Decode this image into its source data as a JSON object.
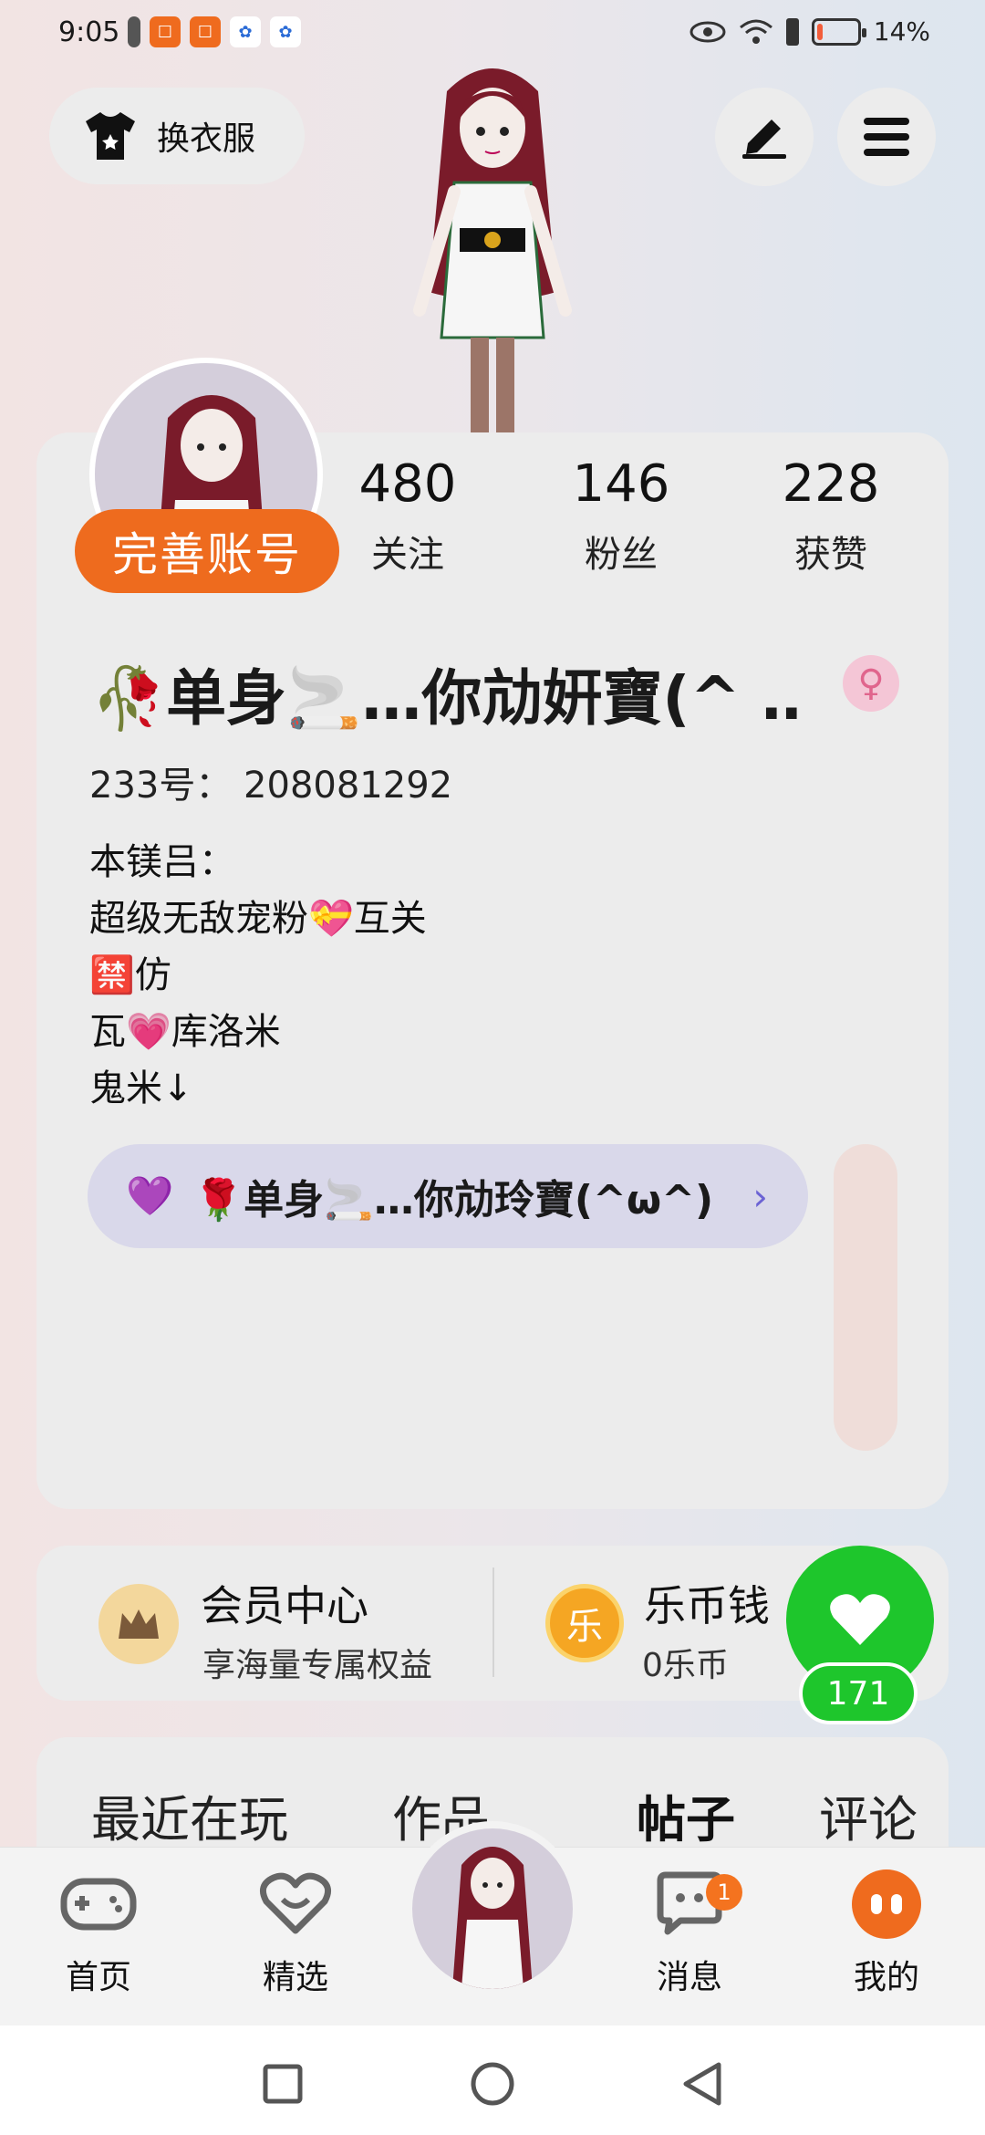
{
  "status_bar": {
    "time": "9:05",
    "battery": "14%",
    "battery_level": 0.14,
    "icons": [
      "alert-icon",
      "app-icon",
      "app-icon",
      "paw-icon",
      "paw-icon",
      "eye-icon",
      "wifi-icon",
      "alert-icon",
      "battery-icon"
    ]
  },
  "header": {
    "dress_label": "换衣服",
    "edit_icon": "edit-icon",
    "menu_icon": "menu-icon"
  },
  "profile": {
    "badge": "完善账号",
    "stats": [
      {
        "value": "480",
        "label": "关注"
      },
      {
        "value": "146",
        "label": "粉丝"
      },
      {
        "value": "228",
        "label": "获赞"
      }
    ],
    "nickname": "🥀单身🚬…你劥姸寶(^ …",
    "gender_symbol": "♀",
    "uid": "233号： 208081292",
    "bio_lines": [
      "本镁吕：",
      "超级无敌宠粉💝互关",
      "🈲仿",
      "瓦💗库洛米",
      "鬼米↓"
    ],
    "link_text": "🌹单身🚬…你劥玲寶(^ω^)",
    "link_heart": "💜"
  },
  "member": {
    "title": "会员中心",
    "subtitle": "享海量专属权益"
  },
  "coins": {
    "title": "乐币钱",
    "subtitle": "0乐币",
    "coin_char": "乐"
  },
  "like": {
    "count": "171"
  },
  "tabs": [
    {
      "label": "最近在玩"
    },
    {
      "label": "作品"
    },
    {
      "label": "帖子"
    },
    {
      "label": "评论"
    }
  ],
  "nav": {
    "home": "首页",
    "featured": "精选",
    "messages": "消息",
    "messages_badge": "1",
    "mine": "我的"
  },
  "colors": {
    "accent_orange": "#ee6b1e",
    "like_green": "#1ec62c",
    "link_purple": "#6c63d4"
  }
}
